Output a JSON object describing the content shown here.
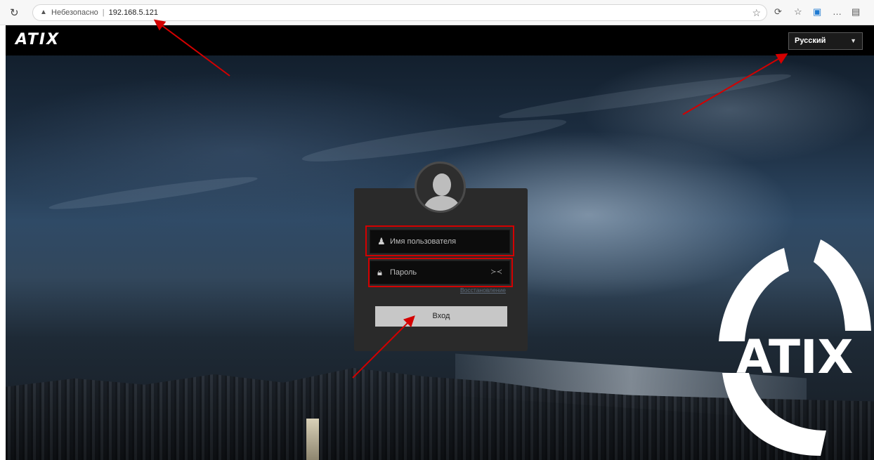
{
  "browser": {
    "security_label": "Небезопасно",
    "url": "192.168.5.121"
  },
  "header": {
    "brand": "ATIX",
    "language": "Русский"
  },
  "login": {
    "username_placeholder": "Имя пользователя",
    "password_placeholder": "Пароль",
    "recover_link": "Восстановление",
    "submit_label": "Вход"
  },
  "background_logo": {
    "text": "ATIX"
  },
  "colors": {
    "highlight": "#d40000",
    "button": "#c7c7c7",
    "header": "#000000"
  }
}
